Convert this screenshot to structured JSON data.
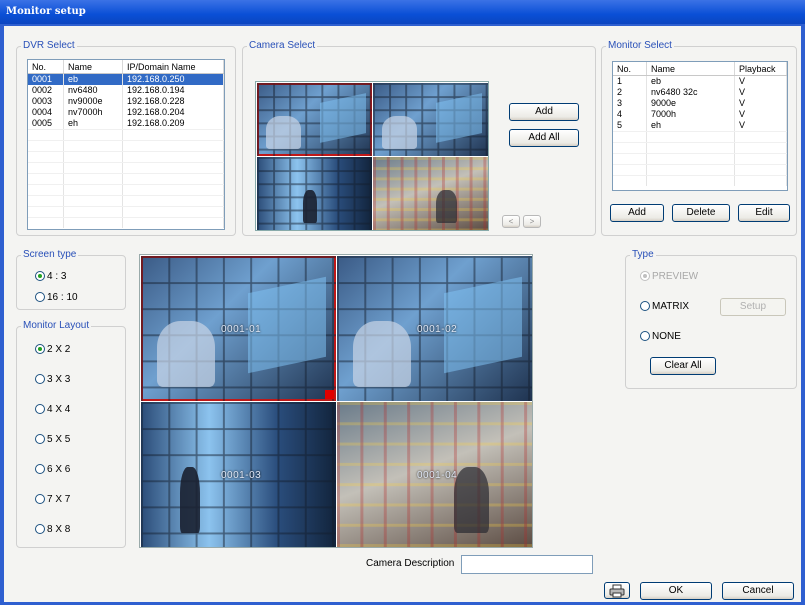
{
  "window": {
    "title": "Monitor setup"
  },
  "dvr_select": {
    "label": "DVR Select",
    "columns": [
      "No.",
      "Name",
      "IP/Domain Name"
    ],
    "rows": [
      [
        "0001",
        "eb",
        "192.168.0.250"
      ],
      [
        "0002",
        "nv6480",
        "192.168.0.194"
      ],
      [
        "0003",
        "nv9000e",
        "192.168.0.228"
      ],
      [
        "0004",
        "nv7000h",
        "192.168.0.204"
      ],
      [
        "0005",
        "eh",
        "192.168.0.209"
      ]
    ],
    "selected_row": 0
  },
  "camera_select": {
    "label": "Camera Select",
    "add_label": "Add",
    "add_all_label": "Add All",
    "prev_label": "<",
    "next_label": ">"
  },
  "monitor_select": {
    "label": "Monitor Select",
    "columns": [
      "No.",
      "Name",
      "Playback"
    ],
    "rows": [
      [
        "1",
        "eb",
        "V"
      ],
      [
        "2",
        "nv6480 32c",
        "V"
      ],
      [
        "3",
        "9000e",
        "V"
      ],
      [
        "4",
        "7000h",
        "V"
      ],
      [
        "5",
        "eh",
        "V"
      ]
    ],
    "add_label": "Add",
    "delete_label": "Delete",
    "edit_label": "Edit"
  },
  "screen_type": {
    "label": "Screen type",
    "options": [
      "4 : 3",
      "16 : 10"
    ],
    "selected": "4 : 3"
  },
  "monitor_layout": {
    "label": "Monitor Layout",
    "options": [
      "2 X 2",
      "3 X 3",
      "4 X 4",
      "5 X 5",
      "6 X 6",
      "7 X 7",
      "8 X 8"
    ],
    "selected": "2 X 2"
  },
  "preview": {
    "cells": [
      "0001-01",
      "0001-02",
      "0001-03",
      "0001-04"
    ]
  },
  "type": {
    "label": "Type",
    "preview_label": "PREVIEW",
    "matrix_label": "MATRIX",
    "none_label": "NONE",
    "setup_label": "Setup",
    "clear_all_label": "Clear All",
    "selected": "PREVIEW"
  },
  "camera_description": {
    "label": "Camera Description",
    "value": ""
  },
  "footer": {
    "ok_label": "OK",
    "cancel_label": "Cancel",
    "print_icon": "printer-icon"
  },
  "colors": {
    "accent": "#316ac5",
    "title": "#0a4fd6",
    "highlight": "#c01818"
  }
}
